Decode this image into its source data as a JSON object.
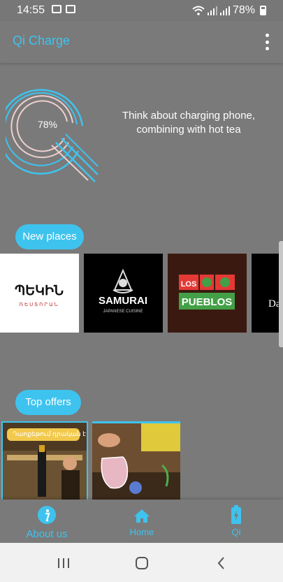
{
  "status_bar": {
    "time": "14:55",
    "battery_percent": "78%",
    "icons": [
      "image-icon",
      "cast-icon",
      "wifi-icon",
      "signal-icon",
      "signal-icon",
      "battery-icon"
    ]
  },
  "app_bar": {
    "title": "Qi Charge",
    "menu_icon": "overflow-menu-icon"
  },
  "hero": {
    "charge_percent": "78%",
    "tagline": "Think about charging phone, combining with hot tea"
  },
  "new_places": {
    "label": "New places",
    "items": [
      {
        "logo_text": "ՊԵԿԻՆ",
        "sub_text": "ՌԵՍՏՈՐԱՆ"
      },
      {
        "logo_text": "SAMURAI",
        "sub_text": "JAPANESE CUISINE"
      },
      {
        "logo_text_top": "LOS",
        "logo_text_bottom": "PUEBLOS"
      },
      {
        "logo_text": "Da"
      }
    ]
  },
  "top_offers": {
    "label": "Top offers",
    "items": [
      {
        "banner_text": "Դաոքեթում դրական է"
      },
      {
        "banner_text": ""
      }
    ]
  },
  "bottom_nav": {
    "items": [
      {
        "label": "About us",
        "icon": "info-icon"
      },
      {
        "label": "Home",
        "icon": "home-icon"
      },
      {
        "label": "Qi",
        "icon": "battery-charging-icon"
      }
    ]
  },
  "colors": {
    "accent": "#3ec3ee",
    "background": "#7a7a7a",
    "logo_ring": "#3ec3ee",
    "logo_ring_inner": "#f0cfcf"
  }
}
